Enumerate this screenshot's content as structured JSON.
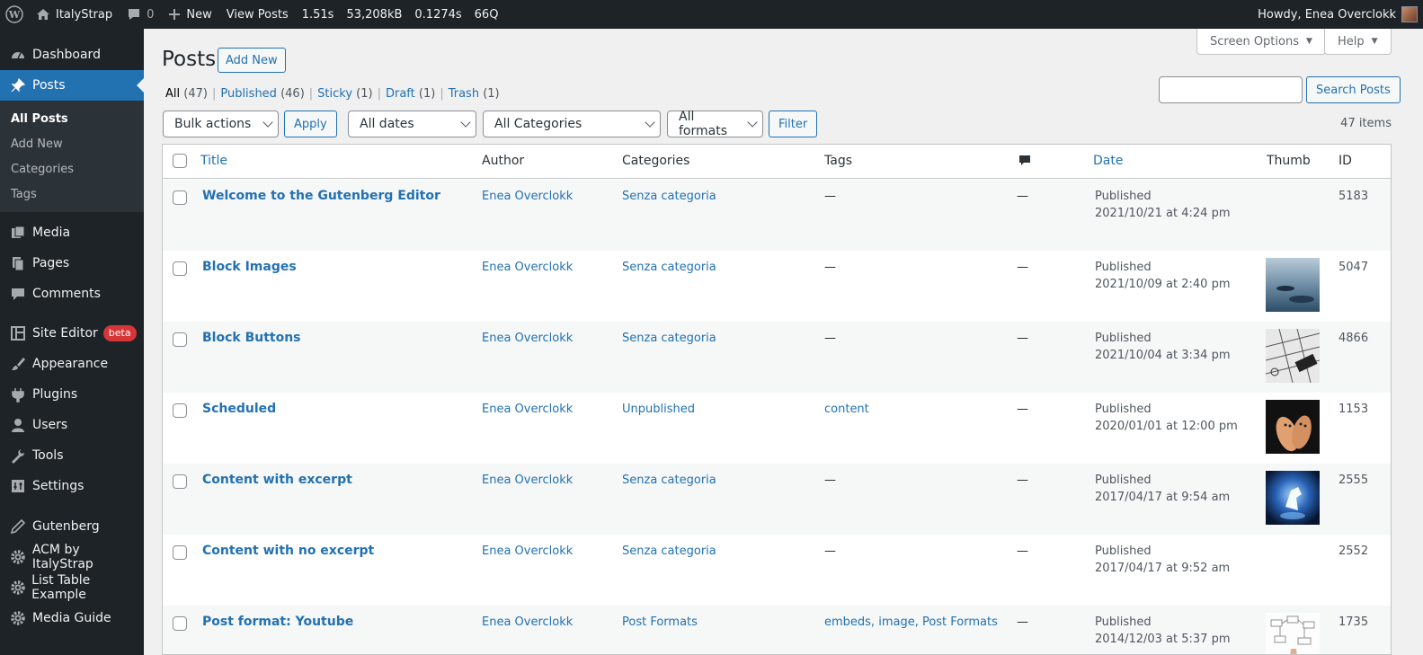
{
  "adminbar": {
    "site_name": "ItalyStrap",
    "comments_count": "0",
    "new_label": "New",
    "view_posts": "View Posts",
    "stats": [
      "1.51s",
      "53,208kB",
      "0.1274s",
      "66Q"
    ],
    "howdy": "Howdy, Enea Overclokk"
  },
  "sidebar": {
    "items": [
      {
        "label": "Dashboard",
        "icon": "dashboard-icon"
      },
      {
        "label": "Posts",
        "icon": "pin-icon"
      },
      {
        "label": "Media",
        "icon": "media-icon"
      },
      {
        "label": "Pages",
        "icon": "pages-icon"
      },
      {
        "label": "Comments",
        "icon": "comment-icon"
      },
      {
        "label": "Site Editor",
        "icon": "layout-icon",
        "badge": "beta"
      },
      {
        "label": "Appearance",
        "icon": "brush-icon"
      },
      {
        "label": "Plugins",
        "icon": "plug-icon"
      },
      {
        "label": "Users",
        "icon": "user-icon"
      },
      {
        "label": "Tools",
        "icon": "wrench-icon"
      },
      {
        "label": "Settings",
        "icon": "settings-icon"
      },
      {
        "label": "Gutenberg",
        "icon": "pen-icon"
      },
      {
        "label": "ACM by ItalyStrap",
        "icon": "gear-icon"
      },
      {
        "label": "List Table Example",
        "icon": "gear-icon"
      },
      {
        "label": "Media Guide",
        "icon": "gear-icon"
      }
    ],
    "posts_submenu": [
      "All Posts",
      "Add New",
      "Categories",
      "Tags"
    ]
  },
  "header": {
    "screen_options": "Screen Options",
    "help": "Help",
    "title": "Posts",
    "add_new": "Add New"
  },
  "views": [
    {
      "label": "All",
      "count": "(47)"
    },
    {
      "label": "Published",
      "count": "(46)"
    },
    {
      "label": "Sticky",
      "count": "(1)"
    },
    {
      "label": "Draft",
      "count": "(1)"
    },
    {
      "label": "Trash",
      "count": "(1)"
    }
  ],
  "search": {
    "button": "Search Posts",
    "value": ""
  },
  "filters": {
    "bulk_actions": "Bulk actions",
    "apply": "Apply",
    "dates": "All dates",
    "categories": "All Categories",
    "formats": "All formats",
    "filter": "Filter",
    "items_count": "47 items"
  },
  "table": {
    "columns": {
      "title": "Title",
      "author": "Author",
      "categories": "Categories",
      "tags": "Tags",
      "date": "Date",
      "thumb": "Thumb",
      "id": "ID"
    },
    "rows": [
      {
        "title": "Welcome to the Gutenberg Editor",
        "author": "Enea Overclokk",
        "categories": "Senza categoria",
        "tags": "—",
        "comments": "—",
        "status": "Published",
        "date": "2021/10/21 at 4:24 pm",
        "id": "5183",
        "thumb": ""
      },
      {
        "title": "Block Images",
        "author": "Enea Overclokk",
        "categories": "Senza categoria",
        "tags": "—",
        "comments": "—",
        "status": "Published",
        "date": "2021/10/09 at 2:40 pm",
        "id": "5047",
        "thumb": "sea"
      },
      {
        "title": "Block Buttons",
        "author": "Enea Overclokk",
        "categories": "Senza categoria",
        "tags": "—",
        "comments": "—",
        "status": "Published",
        "date": "2021/10/04 at 3:34 pm",
        "id": "4866",
        "thumb": "keyboard"
      },
      {
        "title": "Scheduled",
        "author": "Enea Overclokk",
        "categories": "Unpublished",
        "tags": "content",
        "comments": "—",
        "status": "Published",
        "date": "2020/01/01 at 12:00 pm",
        "id": "1153",
        "thumb": "fingers"
      },
      {
        "title": "Content with excerpt",
        "author": "Enea Overclokk",
        "categories": "Senza categoria",
        "tags": "—",
        "comments": "—",
        "status": "Published",
        "date": "2017/04/17 at 9:54 am",
        "id": "2555",
        "thumb": "unicorn"
      },
      {
        "title": "Content with no excerpt",
        "author": "Enea Overclokk",
        "categories": "Senza categoria",
        "tags": "—",
        "comments": "—",
        "status": "Published",
        "date": "2017/04/17 at 9:52 am",
        "id": "2552",
        "thumb": ""
      },
      {
        "title": "Post format: Youtube",
        "author": "Enea Overclokk",
        "categories": "Post Formats",
        "tags": "embeds, image, Post Formats",
        "comments": "—",
        "status": "Published",
        "date": "2014/12/03 at 5:37 pm",
        "id": "1735",
        "thumb": "diagram"
      }
    ]
  }
}
